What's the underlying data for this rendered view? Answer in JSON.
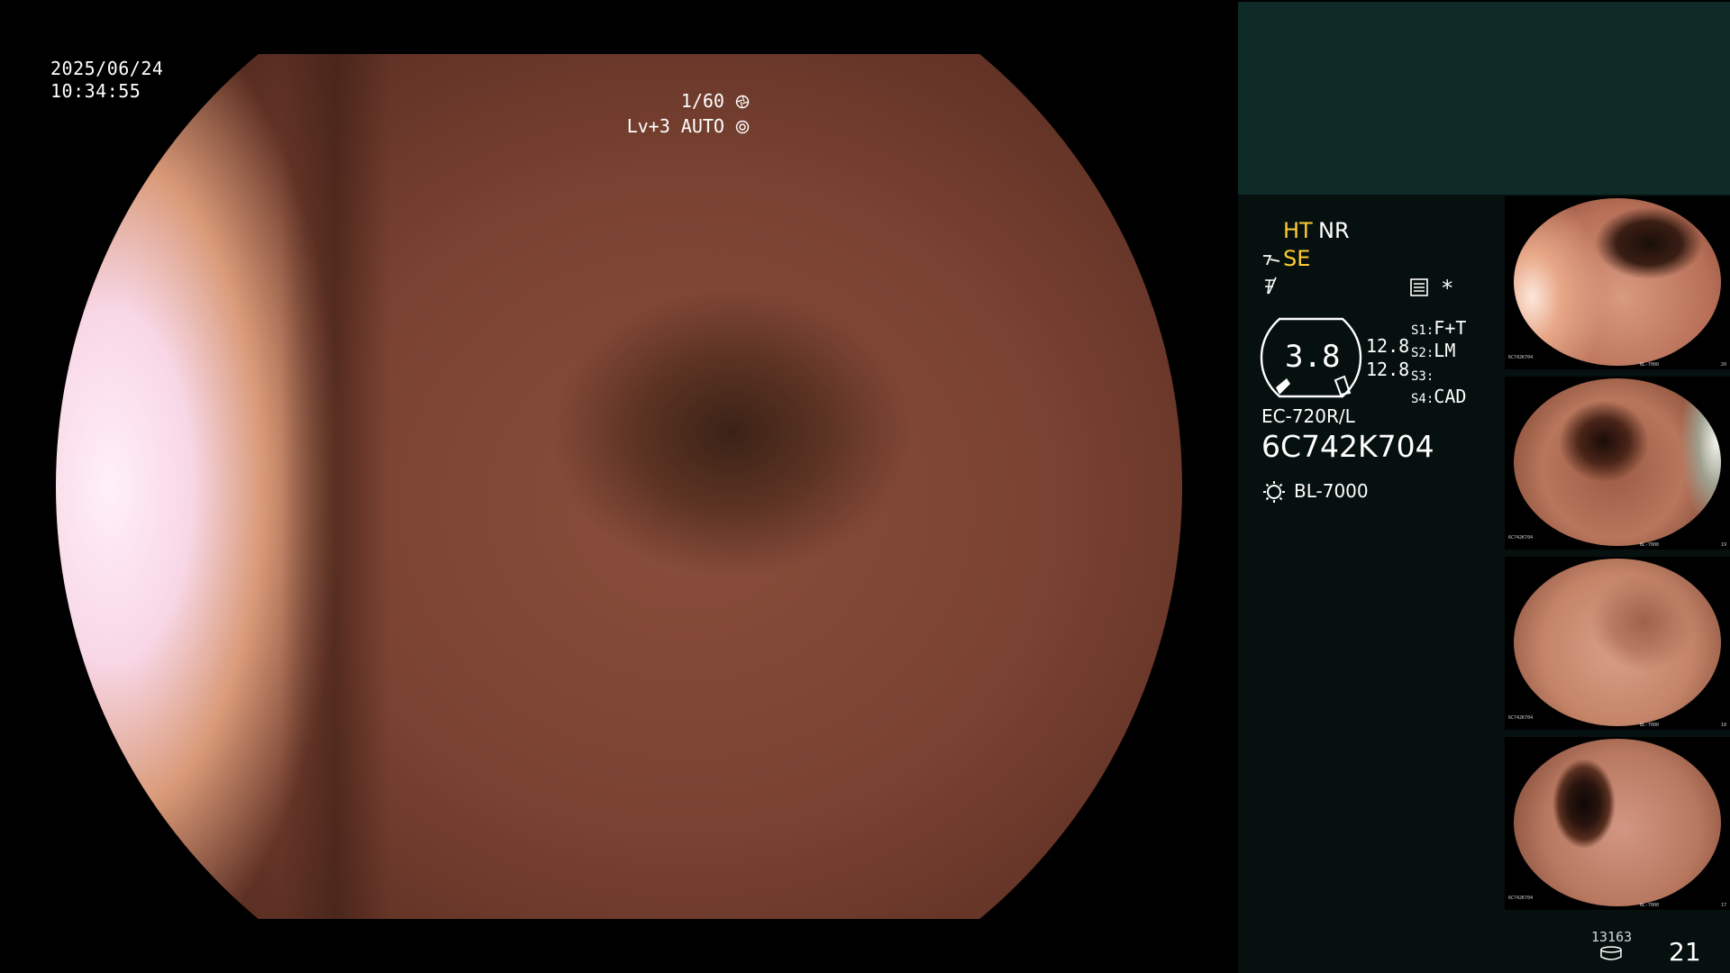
{
  "overlay": {
    "date": "2025/06/24",
    "time": "10:34:55",
    "shutter": "1/60",
    "shutter_icon": "aperture-icon",
    "level": "Lv+3 AUTO",
    "level_icon": "iris-icon"
  },
  "panel": {
    "mode_ht": "HT",
    "mode_nr": "NR",
    "mode_se": "SE",
    "se_icon": "structure-enhance-icon",
    "filter_icon": "filter-off-icon",
    "settings_icon": "settings-list-icon",
    "asterisk": "*",
    "gauge_value": "3.8",
    "value_upper": "12.8",
    "value_lower": "12.8",
    "switches": [
      {
        "key": "S1",
        "value": "F+T"
      },
      {
        "key": "S2",
        "value": "LM"
      },
      {
        "key": "S3",
        "value": ""
      },
      {
        "key": "S4",
        "value": "CAD"
      }
    ],
    "scope_model": "EC-720R/L",
    "serial": "6C742K704",
    "light_source": "BL-7000",
    "light_icon": "light-source-icon",
    "capture_count": "13163",
    "storage_icon": "storage-icon",
    "frame_number": "21"
  },
  "thumbnails": [
    {
      "index": "20",
      "serial": "6C742K704",
      "light": "BL-7000"
    },
    {
      "index": "19",
      "serial": "6C742K704",
      "light": "BL-7000"
    },
    {
      "index": "18",
      "serial": "6C742K704",
      "light": "BL-7000"
    },
    {
      "index": "17",
      "serial": "6C742K704",
      "light": "BL-7000"
    }
  ]
}
